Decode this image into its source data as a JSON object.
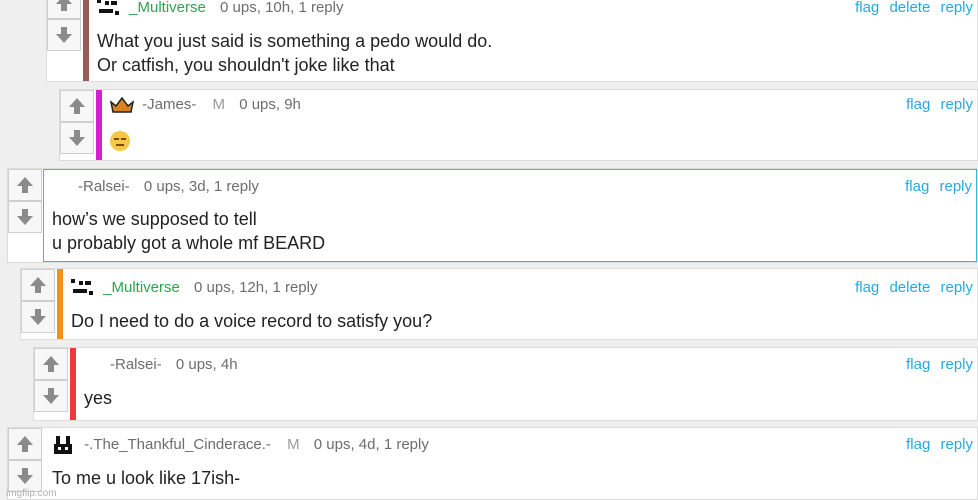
{
  "colors": {
    "link": "#26a9e0",
    "green_user": "#2ea44f",
    "bar_maroon": "#9b5a5a",
    "bar_magenta": "#d61ed2",
    "bar_cyan": "#3fb8d6",
    "bar_orange": "#f0921c",
    "bar_red": "#f03a3a"
  },
  "icons": {
    "upvote": "arrow-up-icon",
    "downvote": "arrow-down-icon"
  },
  "comments": [
    {
      "user": "_Multiverse",
      "meta": "0 ups, 10h, 1 reply",
      "line1": "What you just said is something a pedo would do.",
      "line2": "Or catfish, you shouldn't joke like that",
      "actions": [
        "flag",
        "delete",
        "reply"
      ]
    },
    {
      "user": "-James-",
      "mod": "M",
      "meta": "0 ups, 9h",
      "emoji": "expressionless-face-emoji",
      "actions": [
        "flag",
        "reply"
      ]
    },
    {
      "user": "-Ralsei-",
      "meta": "0 ups, 3d, 1 reply",
      "line1": "how’s we supposed to tell",
      "line2": "u probably got a whole mf BEARD",
      "actions": [
        "flag",
        "reply"
      ]
    },
    {
      "user": "_Multiverse",
      "meta": "0 ups, 12h, 1 reply",
      "line1": "Do I need to do a voice record to satisfy you?",
      "actions": [
        "flag",
        "delete",
        "reply"
      ]
    },
    {
      "user": "-Ralsei-",
      "meta": "0 ups, 4h",
      "line1": "yes",
      "actions": [
        "flag",
        "reply"
      ]
    },
    {
      "user": "-.The_Thankful_Cinderace.-",
      "mod": "M",
      "meta": "0 ups, 4d, 1 reply",
      "line1": "To me u look like 17ish-",
      "actions": [
        "flag",
        "reply"
      ]
    }
  ],
  "watermark": "imgflip.com"
}
